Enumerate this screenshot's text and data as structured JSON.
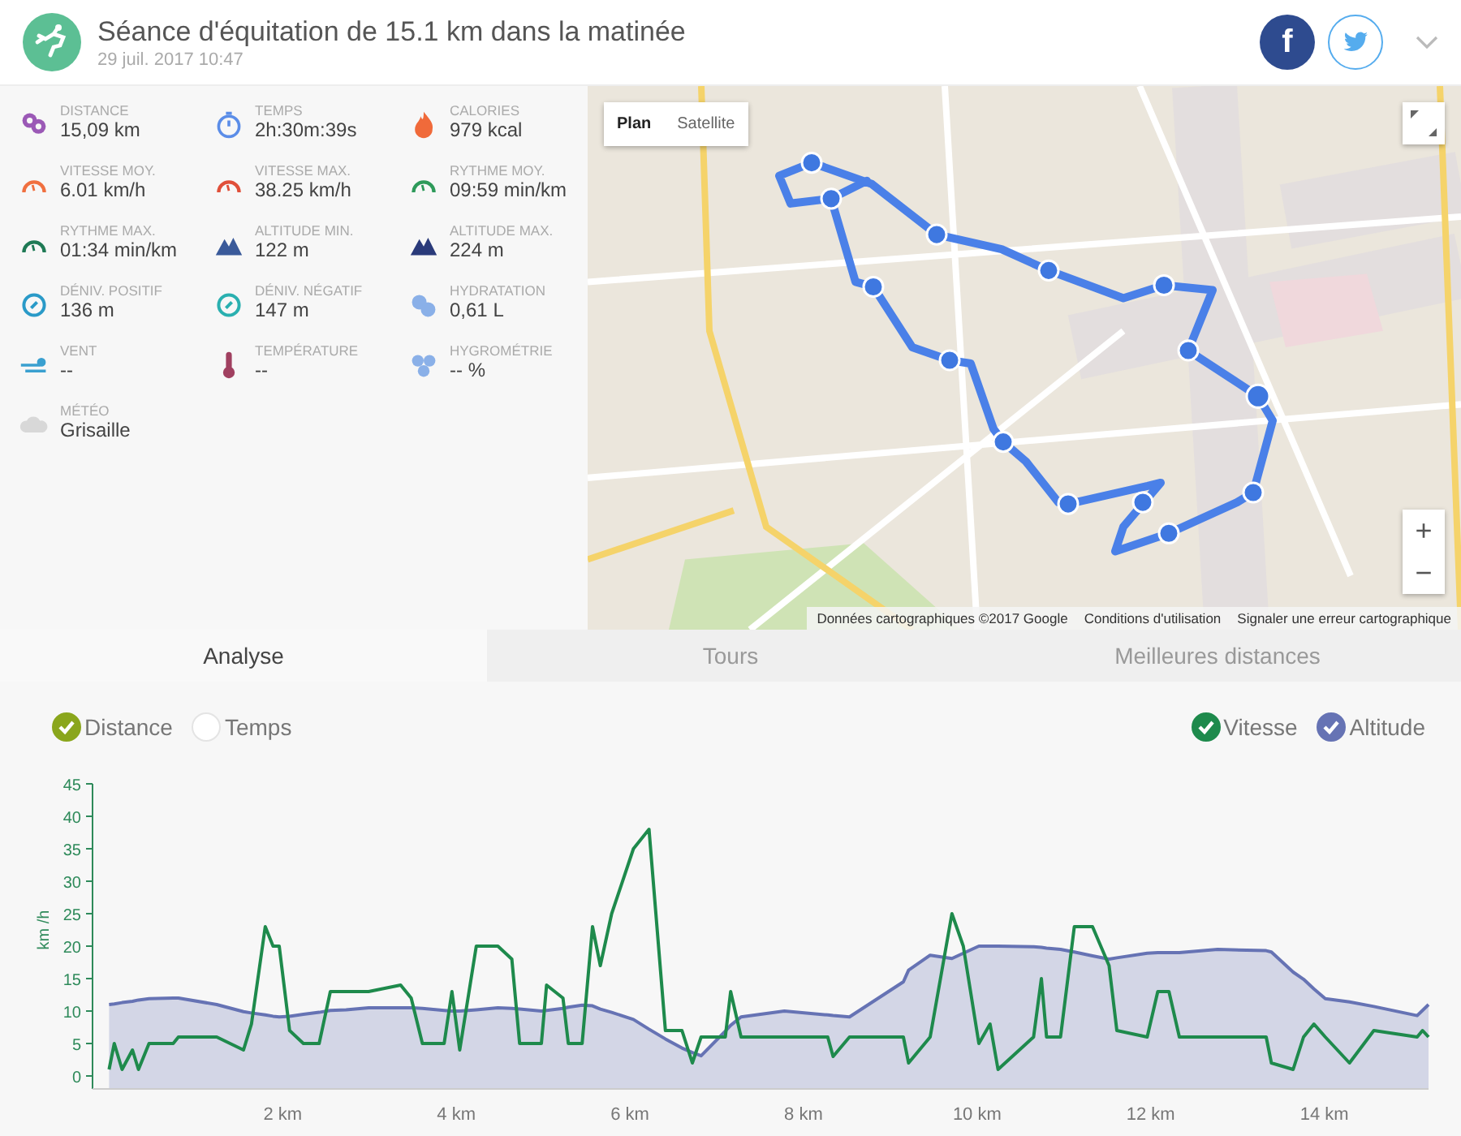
{
  "header": {
    "title": "Séance d'équitation de 15.1 km dans la matinée",
    "date": "29 juil. 2017 10:47",
    "share": [
      {
        "kind": "facebook",
        "glyph": "f"
      },
      {
        "kind": "twitter"
      }
    ]
  },
  "stats": [
    {
      "label": "DISTANCE",
      "value": "15,09 km"
    },
    {
      "label": "TEMPS",
      "value": "2h:30m:39s"
    },
    {
      "label": "CALORIES",
      "value": "979 kcal"
    },
    {
      "label": "VITESSE MOY.",
      "value": "6.01 km/h"
    },
    {
      "label": "VITESSE MAX.",
      "value": "38.25 km/h"
    },
    {
      "label": "RYTHME MOY.",
      "value": "09:59 min/km"
    },
    {
      "label": "RYTHME MAX.",
      "value": "01:34 min/km"
    },
    {
      "label": "ALTITUDE MIN.",
      "value": "122 m"
    },
    {
      "label": "ALTITUDE MAX.",
      "value": "224 m"
    },
    {
      "label": "DÉNIV. POSITIF",
      "value": "136 m"
    },
    {
      "label": "DÉNIV. NÉGATIF",
      "value": "147 m"
    },
    {
      "label": "HYDRATATION",
      "value": "0,61 L"
    },
    {
      "label": "VENT",
      "value": "--"
    },
    {
      "label": "TEMPÉRATURE",
      "value": "--"
    },
    {
      "label": "HYGROMÉTRIE",
      "value": "-- %"
    },
    {
      "label": "MÉTÉO",
      "value": "Grisaille"
    }
  ],
  "map": {
    "map_types": [
      {
        "label": "Plan",
        "selected": true
      },
      {
        "label": "Satellite",
        "selected": false
      }
    ],
    "zoom_in": "+",
    "zoom_out": "−",
    "attribution": [
      "Données cartographiques ©2017 Google",
      "Conditions d'utilisation",
      "Signaler une erreur cartographique"
    ]
  },
  "tabs": [
    {
      "label": "Analyse",
      "selected": true
    },
    {
      "label": "Tours",
      "selected": false
    },
    {
      "label": "Meilleures distances",
      "selected": false
    }
  ],
  "axis_options": [
    {
      "label": "Distance",
      "selected": true
    },
    {
      "label": "Temps",
      "selected": false
    }
  ],
  "series_toggles": [
    {
      "checked": true,
      "color": "#1e8a4c"
    },
    {
      "checked": true,
      "color": "#6673b4"
    }
  ],
  "chart_data": {
    "type": "line",
    "ylabel": "km /h",
    "ylim": [
      -2,
      45
    ],
    "yticks": [
      0,
      5,
      10,
      15,
      20,
      25,
      30,
      35,
      40,
      45
    ],
    "xlim": [
      -0.19,
      15.2
    ],
    "xticks": [
      {
        "value": 2,
        "label": "2 km"
      },
      {
        "value": 4,
        "label": "4 km"
      },
      {
        "value": 6,
        "label": "6 km"
      },
      {
        "value": 8,
        "label": "8 km"
      },
      {
        "value": 10,
        "label": "10 km"
      },
      {
        "value": 12,
        "label": "12 km"
      },
      {
        "value": 14,
        "label": "14 km"
      }
    ],
    "x": [
      0,
      0.06,
      0.15,
      0.27,
      0.34,
      0.46,
      0.74,
      0.8,
      1.24,
      1.55,
      1.64,
      1.8,
      1.89,
      1.96,
      2.08,
      2.24,
      2.42,
      2.55,
      2.73,
      2.99,
      3.36,
      3.48,
      3.61,
      3.86,
      3.95,
      4.04,
      4.23,
      4.48,
      4.64,
      4.73,
      4.98,
      5.04,
      5.23,
      5.29,
      5.45,
      5.57,
      5.66,
      5.79,
      6.04,
      6.22,
      6.41,
      6.6,
      6.72,
      6.82,
      7.1,
      7.16,
      7.28,
      7.78,
      8.28,
      8.34,
      8.53,
      9.15,
      9.21,
      9.46,
      9.71,
      9.84,
      10.02,
      10.15,
      10.24,
      10.65,
      10.74,
      10.8,
      10.96,
      11.12,
      11.33,
      11.52,
      11.61,
      11.96,
      12.08,
      12.21,
      12.33,
      12.77,
      13.33,
      13.39,
      13.64,
      13.76,
      13.88,
      14.01,
      14.29,
      14.57,
      15.07,
      15.13,
      15.2
    ],
    "series": [
      {
        "name": "Vitesse",
        "color": "#1e8a4c",
        "values": [
          1,
          5,
          1,
          4,
          1,
          5,
          5,
          6,
          6,
          4,
          8,
          23,
          20,
          20,
          7,
          5,
          5,
          13,
          13,
          13,
          14,
          12,
          5,
          5,
          13,
          4,
          20,
          20,
          18,
          5,
          5,
          14,
          12,
          5,
          5,
          23,
          17,
          25,
          35,
          38,
          7,
          7,
          2,
          6,
          6,
          13,
          6,
          6,
          6,
          3,
          6,
          6,
          2,
          6,
          25,
          20,
          5,
          8,
          1,
          6,
          15,
          6,
          6,
          23,
          23,
          17,
          7,
          6,
          13,
          13,
          6,
          6,
          6,
          2,
          1,
          6,
          8,
          6,
          2,
          7,
          6,
          7,
          6
        ]
      },
      {
        "name": "Altitude",
        "color": "#6673b4",
        "values": [
          11,
          11.1,
          11.3,
          11.5,
          11.7,
          11.9,
          12,
          12,
          11,
          9.9,
          9.7,
          9.4,
          9.2,
          9.1,
          9.2,
          9.5,
          9.8,
          10.1,
          10.2,
          10.5,
          10.5,
          10.5,
          10.4,
          10.1,
          10,
          10,
          10.2,
          10.5,
          10.4,
          10.3,
          10,
          10.1,
          10.4,
          10.6,
          10.9,
          10.8,
          10.3,
          9.8,
          8.7,
          7.2,
          5.7,
          4.3,
          3.6,
          3.1,
          6.9,
          7.8,
          9.1,
          10,
          9.4,
          9.3,
          9.1,
          14.5,
          16.3,
          18.6,
          18.1,
          18.9,
          20,
          20,
          20,
          19.9,
          19.8,
          19.7,
          19.5,
          19.1,
          18.5,
          18,
          18.2,
          18.9,
          19,
          19,
          19,
          19.5,
          19.3,
          19.1,
          16,
          14.9,
          13.4,
          11.9,
          11.4,
          10.7,
          9.3,
          10.1,
          11
        ]
      }
    ]
  }
}
